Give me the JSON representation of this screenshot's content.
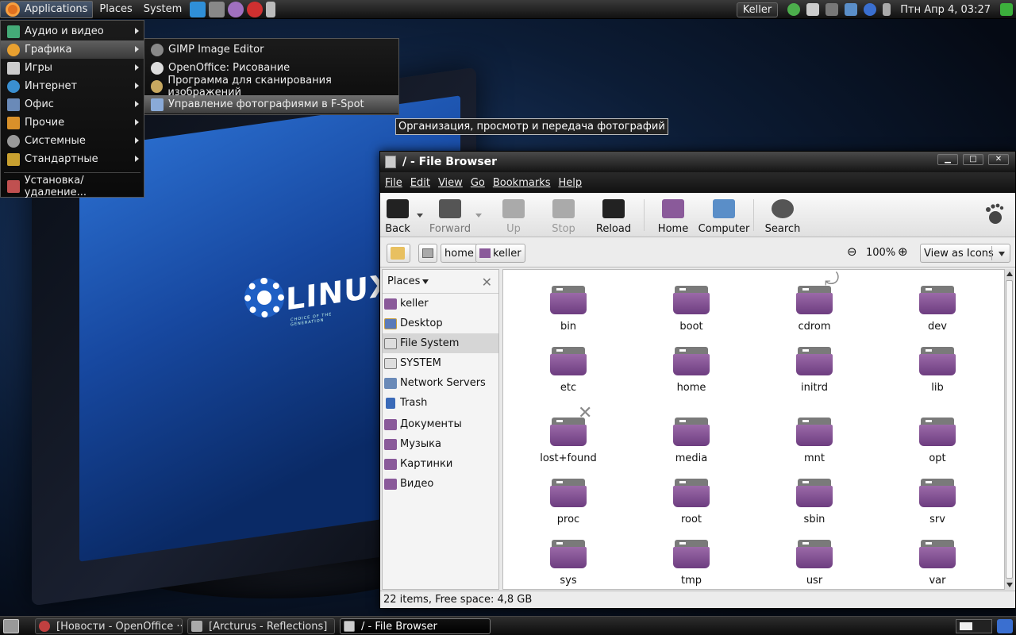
{
  "top_panel": {
    "menus": [
      "Applications",
      "Places",
      "System"
    ],
    "user": "Keller",
    "clock": "Птн Апр  4, 03:27"
  },
  "app_menu": {
    "items": [
      {
        "label": "Аудио и видео",
        "icon": "audio-video-icon",
        "submenu": true
      },
      {
        "label": "Графика",
        "icon": "graphics-icon",
        "submenu": true
      },
      {
        "label": "Игры",
        "icon": "games-icon",
        "submenu": true
      },
      {
        "label": "Интернет",
        "icon": "internet-icon",
        "submenu": true
      },
      {
        "label": "Офис",
        "icon": "office-icon",
        "submenu": true
      },
      {
        "label": "Прочие",
        "icon": "other-icon",
        "submenu": true
      },
      {
        "label": "Системные",
        "icon": "system-icon",
        "submenu": true
      },
      {
        "label": "Стандартные",
        "icon": "accessories-icon",
        "submenu": true
      }
    ],
    "footer_item": "Установка/удаление..."
  },
  "graphics_submenu": {
    "items": [
      {
        "label": "GIMP Image Editor",
        "icon": "gimp-icon"
      },
      {
        "label": "OpenOffice: Рисование",
        "icon": "openoffice-draw-icon"
      },
      {
        "label": "Программа для сканирования изображений",
        "icon": "scanner-icon"
      },
      {
        "label": "Управление фотографиями в F-Spot",
        "icon": "f-spot-icon"
      }
    ]
  },
  "tooltip": "Организация, просмотр и передача фотографий",
  "wallpaper": {
    "logo_word": "LINUX",
    "logo_tagline": "CHOICE OF THE GENERATION"
  },
  "file_browser": {
    "title": "/ - File Browser",
    "menubar": [
      "File",
      "Edit",
      "View",
      "Go",
      "Bookmarks",
      "Help"
    ],
    "toolbar": {
      "back": "Back",
      "forward": "Forward",
      "up": "Up",
      "stop": "Stop",
      "reload": "Reload",
      "home": "Home",
      "computer": "Computer",
      "search": "Search"
    },
    "location": {
      "crumbs": [
        "home",
        "keller"
      ],
      "zoom": "100%",
      "view_mode": "View as Icons"
    },
    "sidebar": {
      "header": "Places",
      "items": [
        {
          "label": "keller",
          "icon": "home-folder-icon",
          "selected": false
        },
        {
          "label": "Desktop",
          "icon": "desktop-icon",
          "selected": false
        },
        {
          "label": "File System",
          "icon": "drive-icon",
          "selected": true
        },
        {
          "label": "SYSTEM",
          "icon": "drive-icon",
          "selected": false
        },
        {
          "label": "Network Servers",
          "icon": "network-icon",
          "selected": false
        },
        {
          "label": "Trash",
          "icon": "trash-icon",
          "selected": false
        }
      ],
      "bookmarks": [
        {
          "label": "Документы",
          "icon": "folder-icon"
        },
        {
          "label": "Музыка",
          "icon": "folder-icon"
        },
        {
          "label": "Картинки",
          "icon": "folder-icon"
        },
        {
          "label": "Видео",
          "icon": "folder-icon"
        }
      ]
    },
    "folders": [
      "bin",
      "boot",
      "cdrom",
      "dev",
      "etc",
      "home",
      "initrd",
      "lib",
      "lost+found",
      "media",
      "mnt",
      "opt",
      "proc",
      "root",
      "sbin",
      "srv",
      "sys",
      "tmp",
      "usr",
      "var"
    ],
    "status": "22 items, Free space: 4,8 GB"
  },
  "taskbar": [
    {
      "label": "[Новости - OpenOffice ···",
      "icon": "openoffice-icon",
      "active": false
    },
    {
      "label": "[Arcturus - Reflections]",
      "icon": "music-player-icon",
      "active": false
    },
    {
      "label": "/ - File Browser",
      "icon": "file-browser-icon",
      "active": true
    }
  ],
  "colors": {
    "folder": "#7d4b8e",
    "panel": "#1a1a1a",
    "wallpaper_screen": "#1e5fc4"
  }
}
